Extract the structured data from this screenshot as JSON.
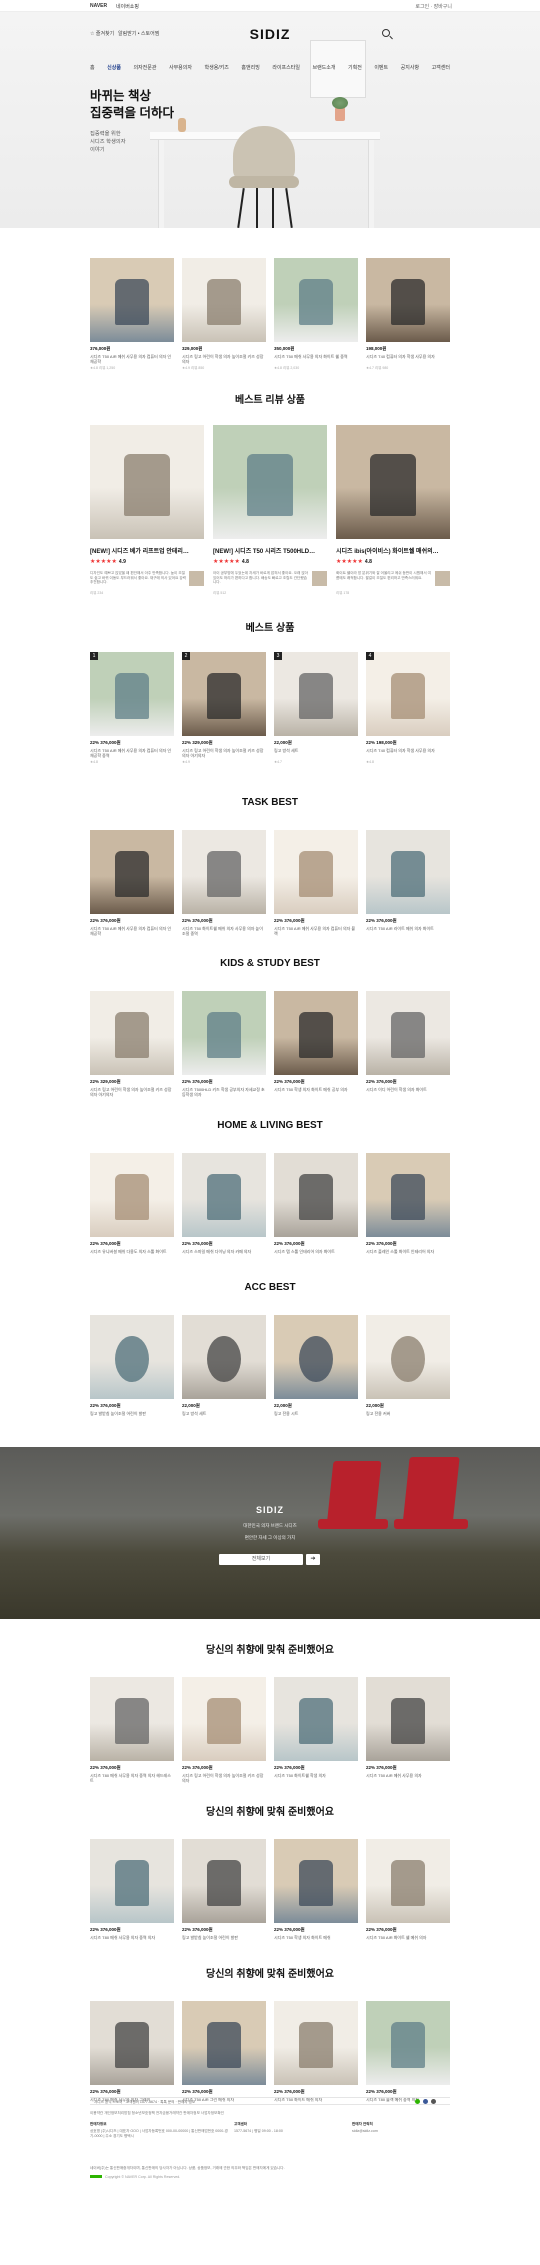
{
  "topbar": {
    "brand": "NAVER",
    "sub": "네이버쇼핑",
    "right": "로그인   ·   장바구니"
  },
  "header": {
    "favorite": "☆ 즐겨찾기",
    "alarm": "알림받기 • 스토어찜",
    "logo": "SIDIZ"
  },
  "gnb": [
    "홈",
    "신상품",
    "의자전문관",
    "사무용의자",
    "학생용/키즈",
    "홈앤리빙",
    "라이프스타일",
    "브랜드소개",
    "기획전",
    "이벤트",
    "공지사항",
    "고객센터"
  ],
  "hero": {
    "line1": "바뀌는 책상",
    "line2": "집중력을 더하다",
    "sub": "집중력을 위한\n시디즈 학생의자\n이야기"
  },
  "featured": [
    {
      "price": "376,000원",
      "name": "시디즈 T50 AIR 메쉬 사무용 의자 컴퓨터 의자 인체공학",
      "meta": "★4.8 리뷰 1,250"
    },
    {
      "price": "329,000원",
      "name": "시디즈 링고 어린이 학생 의자 높이조절 키즈 성장의자",
      "meta": "★4.9 리뷰 850"
    },
    {
      "price": "350,000원",
      "name": "시디즈 T50 메쉬 사무용 의자 화이트 쉘 중역",
      "meta": "★4.8 리뷰 2,030"
    },
    {
      "price": "198,000원",
      "name": "시디즈 T40 컴퓨터 의자 학생 사무용 의자",
      "meta": "★4.7 리뷰 980"
    }
  ],
  "reviews": {
    "title": "베스트 리뷰 상품",
    "items": [
      {
        "title": "[NEW!] 시디즈 베가 리프트업 안테리…",
        "rating": "4.9",
        "text": "디자인도 예쁘고 앉았을 때 편안해서 아주 만족합니다. 높이 조절도 쉽고 바퀴 이동도 부드러워서 좋아요. 재구매 의사 있어요 강력추천합니다.",
        "meta": "리뷰 234"
      },
      {
        "title": "[NEW!] 시디즈 T50 시리즈 T500HLD…",
        "rating": "4.8",
        "text": "아이 공부방에 두었는데 자세가 바르게 잡혀서 좋아요. 오래 앉아 있어도 허리가 편하다고 합니다. 배송도 빠르고 조립도 간단했습니다.",
        "meta": "리뷰 512"
      },
      {
        "title": "시디즈 ibis(아이비스) 화이트쉘 매쉬의…",
        "rating": "4.8",
        "text": "화이트 쉘이라 방 분위기와 잘 어울리고 메쉬 등판이 시원해서 여름에도 쾌적합니다. 팔걸이 조절도 편리하고 만족스러워요.",
        "meta": "리뷰 178"
      }
    ]
  },
  "best": {
    "title": "베스트 상품",
    "items": [
      {
        "rank": "1",
        "price": "22% 376,000원",
        "name": "시디즈 T50 AIR 메쉬 사무용 의자 컴퓨터 의자 인체공학 중역",
        "meta": "★4.8"
      },
      {
        "rank": "2",
        "price": "22% 329,000원",
        "name": "시디즈 링고 어린이 학생 의자 높이조절 키즈 성장의자 아기의자",
        "meta": "★4.9"
      },
      {
        "rank": "3",
        "price": "22,000원",
        "name": "링고 방석 세트",
        "meta": "★4.7"
      },
      {
        "rank": "4",
        "price": "22% 198,000원",
        "name": "시디즈 T40 컴퓨터 의자 학생 사무용 의자",
        "meta": "★4.8"
      }
    ]
  },
  "task": {
    "title": "TASK BEST",
    "items": [
      {
        "price": "22% 376,000원",
        "name": "시디즈 T50 AIR 메쉬 사무용 의자 컴퓨터 의자 인체공학"
      },
      {
        "price": "22% 376,000원",
        "name": "시디즈 T50 화이트쉘 메쉬 의자 사무용 의자 높이조절 중역"
      },
      {
        "price": "22% 376,000원",
        "name": "시디즈 T50 AIR 메쉬 사무용 의자 컴퓨터 의자 블랙"
      },
      {
        "price": "22% 376,000원",
        "name": "시디즈 T50 AIR 라이트 메쉬 의자 화이트"
      }
    ]
  },
  "kids": {
    "title": "KIDS & STUDY BEST",
    "items": [
      {
        "price": "22% 329,000원",
        "name": "시디즈 링고 어린이 학생 의자 높이조절 키즈 성장의자 아기의자"
      },
      {
        "price": "22% 376,000원",
        "name": "시디즈 T500HLD 키즈 학생 공부의자 자세교정 초등학생 의자"
      },
      {
        "price": "22% 376,000원",
        "name": "시디즈 T50 학생 의자 화이트 메쉬 공부 의자"
      },
      {
        "price": "22% 376,000원",
        "name": "시디즈 이디 어린이 학생 의자 화이트"
      }
    ]
  },
  "home": {
    "title": "HOME & LIVING BEST",
    "items": [
      {
        "price": "22% 376,000원",
        "name": "시디즈 유니버셜 메쉬 다용도 의자 스툴 화이트"
      },
      {
        "price": "22% 376,000원",
        "name": "시디즈 스마일 메쉬 다이닝 의자 카페 의자"
      },
      {
        "price": "22% 376,000원",
        "name": "시디즈 탭 스툴 인테리어 의자 화이트"
      },
      {
        "price": "22% 376,000원",
        "name": "시디즈 플레인 스툴 화이트 인테리어 의자"
      }
    ]
  },
  "acc": {
    "title": "ACC BEST",
    "items": [
      {
        "price": "22% 376,000원",
        "name": "링고 발받침 높이조절 어린이 발판"
      },
      {
        "price": "22,000원",
        "name": "링고 방석 세트"
      },
      {
        "price": "22,000원",
        "name": "링고 전용 시트"
      },
      {
        "price": "22,000원",
        "name": "링고 전용 커버"
      }
    ]
  },
  "banner": {
    "title": "SIDIZ",
    "sub1": "대한민국 의자 브랜드 시디즈",
    "sub2": "편안한 자세 그 이상의 가치",
    "input": "전체보기",
    "button": "➔"
  },
  "rec1": {
    "title": "당신의 취향에 맞춰 준비했어요",
    "items": [
      {
        "price": "22% 376,000원",
        "name": "시디즈 T80 메쉬 사무용 의자 중역 의자 헤드레스트"
      },
      {
        "price": "22% 376,000원",
        "name": "시디즈 링고 어린이 학생 의자 높이조절 키즈 성장의자"
      },
      {
        "price": "22% 376,000원",
        "name": "시디즈 T50 화이트쉘 학생 의자"
      },
      {
        "price": "22% 376,000원",
        "name": "시디즈 T50 AIR 메쉬 사무용 의자"
      }
    ]
  },
  "rec2": {
    "title": "당신의 취향에 맞춰 준비했어요",
    "items": [
      {
        "price": "22% 376,000원",
        "name": "시디즈 T80 메쉬 사무용 의자 중역 의자"
      },
      {
        "price": "22% 376,000원",
        "name": "링고 발받침 높이조절 어린이 발판"
      },
      {
        "price": "22% 376,000원",
        "name": "시디즈 T50 학생 의자 화이트 메쉬"
      },
      {
        "price": "22% 376,000원",
        "name": "시디즈 T50 AIR 화이트 쉘 메쉬 의자"
      }
    ]
  },
  "rec3": {
    "title": "당신의 취향에 맞춰 준비했어요",
    "items": [
      {
        "price": "22% 376,000원",
        "name": "시디즈 T80 메쉬 사무용 의자 그레이"
      },
      {
        "price": "22% 376,000원",
        "name": "시디즈 T50 AIR 그린 메쉬 의자"
      },
      {
        "price": "22% 376,000원",
        "name": "시디즈 T50 화이트 메쉬 의자"
      },
      {
        "price": "22% 376,000원",
        "name": "시디즈 T80 블랙 메쉬 중역 의자"
      }
    ]
  },
  "footer": {
    "bar": "시디즈 공식 스토어   ·   고객센터 1577-5674   ·   톡톡 문의   ·   판매자 정보",
    "links": "이용약관   개인정보처리방침   청소년보호정책   전자금융거래약관   판매자정보   사업자정보확인",
    "col1_title": "판매자정보",
    "col1": "상호명 (주)시디즈 | 대표자 OOO | 사업자등록번호 000-00-00000 | 통신판매업번호 0000-경기-0000 | 주소 경기도 평택시",
    "col2_title": "고객센터",
    "col2": "1577-5674 | 평일 09:00 - 18:00",
    "col3_title": "판매자 연락처",
    "col3": "sidiz@sidiz.com",
    "copy": "네이버(주)는 통신판매중개자이며, 통신판매의 당사자가 아닙니다. 상품, 상품정보, 거래에 관한 의무와 책임은 판매자에게 있습니다.",
    "copyright": "Copyright © NAVER Corp. All Rights Reserved."
  }
}
